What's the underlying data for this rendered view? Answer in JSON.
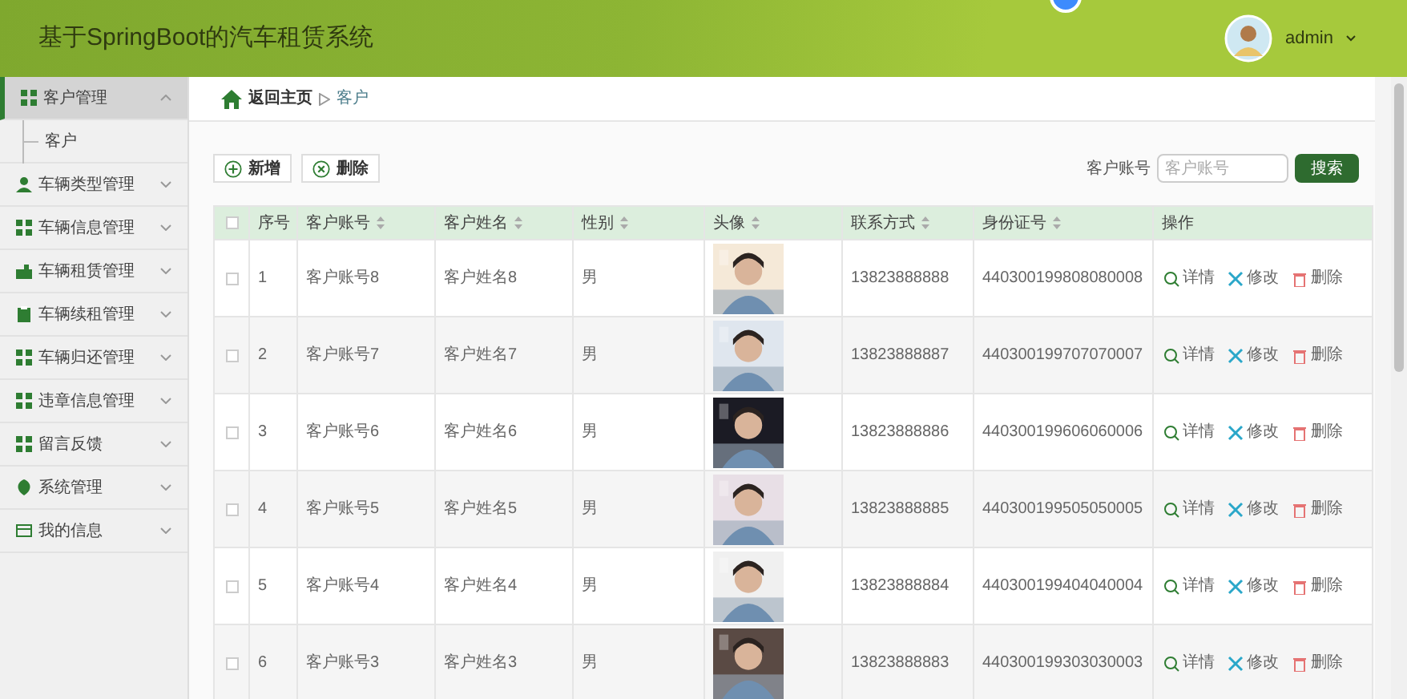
{
  "header": {
    "title": "基于SpringBoot的汽车租赁系统",
    "user": "admin"
  },
  "sidebar": {
    "items": [
      {
        "label": "客户管理",
        "expanded": true,
        "selected": true,
        "children": [
          {
            "label": "客户"
          }
        ]
      },
      {
        "label": "车辆类型管理",
        "expanded": false,
        "selected": false
      },
      {
        "label": "车辆信息管理",
        "expanded": false,
        "selected": false
      },
      {
        "label": "车辆租赁管理",
        "expanded": false,
        "selected": false
      },
      {
        "label": "车辆续租管理",
        "expanded": false,
        "selected": false
      },
      {
        "label": "车辆归还管理",
        "expanded": false,
        "selected": false
      },
      {
        "label": "违章信息管理",
        "expanded": false,
        "selected": false
      },
      {
        "label": "留言反馈",
        "expanded": false,
        "selected": false
      },
      {
        "label": "系统管理",
        "expanded": false,
        "selected": false
      },
      {
        "label": "我的信息",
        "expanded": false,
        "selected": false
      }
    ]
  },
  "breadcrumb": {
    "home": "返回主页",
    "current": "客户"
  },
  "toolbar": {
    "buttons": [
      {
        "label": "新增",
        "kind": "add"
      },
      {
        "label": "删除",
        "kind": "remove"
      }
    ],
    "search_label": "客户账号",
    "search_placeholder": "客户账号",
    "search_button": "搜索"
  },
  "table": {
    "columns": [
      {
        "label": "序号",
        "sortable": false
      },
      {
        "label": "客户账号",
        "sortable": true
      },
      {
        "label": "客户姓名",
        "sortable": true
      },
      {
        "label": "性别",
        "sortable": true
      },
      {
        "label": "头像",
        "sortable": true
      },
      {
        "label": "联系方式",
        "sortable": true
      },
      {
        "label": "身份证号",
        "sortable": true
      },
      {
        "label": "操作",
        "sortable": false
      }
    ],
    "all_checked": false,
    "rows": [
      {
        "index": "1",
        "account": "客户账号8",
        "name": "客户姓名8",
        "gender": "男",
        "phone": "13823888888",
        "id_number": "440300199808080008",
        "checked": false,
        "actions": [
          {
            "label": "详情",
            "kind": "detail"
          },
          {
            "label": "修改",
            "kind": "edit"
          },
          {
            "label": "删除",
            "kind": "delete"
          }
        ]
      },
      {
        "index": "2",
        "account": "客户账号7",
        "name": "客户姓名7",
        "gender": "男",
        "phone": "13823888887",
        "id_number": "440300199707070007",
        "checked": false,
        "actions": [
          {
            "label": "详情",
            "kind": "detail"
          },
          {
            "label": "修改",
            "kind": "edit"
          },
          {
            "label": "删除",
            "kind": "delete"
          }
        ]
      },
      {
        "index": "3",
        "account": "客户账号6",
        "name": "客户姓名6",
        "gender": "男",
        "phone": "13823888886",
        "id_number": "440300199606060006",
        "checked": false,
        "actions": [
          {
            "label": "详情",
            "kind": "detail"
          },
          {
            "label": "修改",
            "kind": "edit"
          },
          {
            "label": "删除",
            "kind": "delete"
          }
        ]
      },
      {
        "index": "4",
        "account": "客户账号5",
        "name": "客户姓名5",
        "gender": "男",
        "phone": "13823888885",
        "id_number": "440300199505050005",
        "checked": false,
        "actions": [
          {
            "label": "详情",
            "kind": "detail"
          },
          {
            "label": "修改",
            "kind": "edit"
          },
          {
            "label": "删除",
            "kind": "delete"
          }
        ]
      },
      {
        "index": "5",
        "account": "客户账号4",
        "name": "客户姓名4",
        "gender": "男",
        "phone": "13823888884",
        "id_number": "440300199404040004",
        "checked": false,
        "actions": [
          {
            "label": "详情",
            "kind": "detail"
          },
          {
            "label": "修改",
            "kind": "edit"
          },
          {
            "label": "删除",
            "kind": "delete"
          }
        ]
      },
      {
        "index": "6",
        "account": "客户账号3",
        "name": "客户姓名3",
        "gender": "男",
        "phone": "13823888883",
        "id_number": "440300199303030003",
        "checked": false,
        "actions": [
          {
            "label": "详情",
            "kind": "detail"
          },
          {
            "label": "修改",
            "kind": "edit"
          },
          {
            "label": "删除",
            "kind": "delete"
          }
        ]
      }
    ]
  }
}
